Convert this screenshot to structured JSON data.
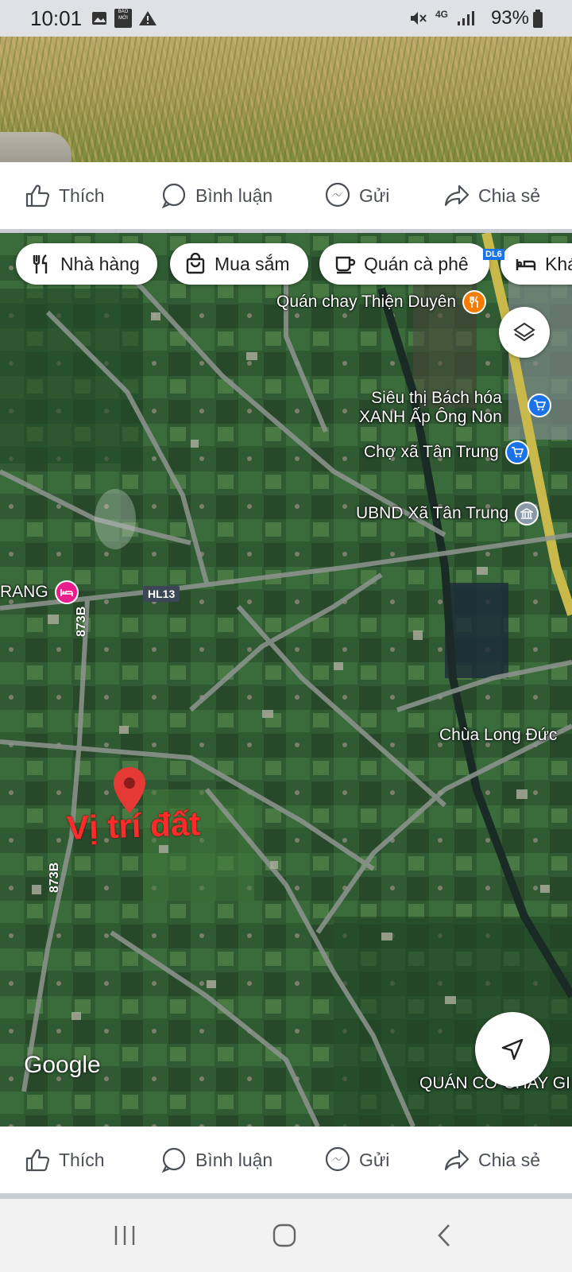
{
  "status_bar": {
    "time": "10:01",
    "notification_badge": "BÁO MỚI",
    "network": "4G",
    "battery": "93%"
  },
  "post_actions": {
    "like": "Thích",
    "comment": "Bình luận",
    "send": "Gửi",
    "share": "Chia sẻ"
  },
  "map": {
    "categories": [
      "Nhà hàng",
      "Mua sắm",
      "Quán cà phê",
      "Khá"
    ],
    "pois": {
      "restaurant": "Quán chay Thiện Duyên",
      "supermarket_line1": "Siêu thị Bách hóa",
      "supermarket_line2": "XANH Ấp Ông Non",
      "market": "Chợ xã Tân Trung",
      "office": "UBND Xã Tân Trung",
      "pagoda": "Chùa Long Đức",
      "hotel": "RANG",
      "bottom": "QUÁN CƠ CHAY GI"
    },
    "roads": {
      "hl13": "HL13",
      "r873b_top": "873B",
      "r873b_bottom": "873B",
      "top_shield": "DL6"
    },
    "annotation": "Vị trí đất",
    "attribution": "Google",
    "colors": {
      "pin": "#e53935",
      "annotation": "#ff2a2a",
      "poi_orange": "#f57c00",
      "poi_blue": "#1a73e8",
      "poi_pink": "#e91e8c",
      "poi_gray": "#8a9aa8"
    }
  }
}
